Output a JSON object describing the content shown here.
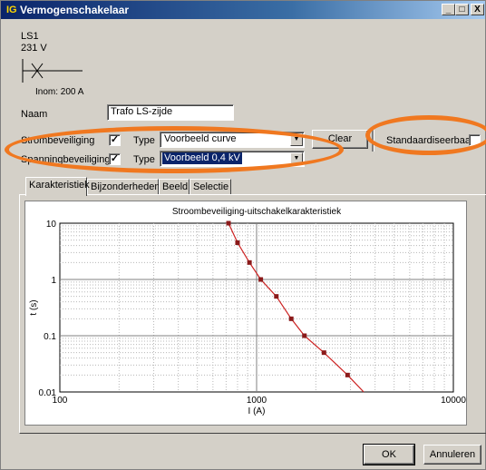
{
  "window": {
    "title": "Vermogenschakelaar",
    "app_icon": "IG",
    "controls": {
      "minimize": "_",
      "maximize": "□",
      "close": "X"
    }
  },
  "symbol": {
    "name": "LS1",
    "voltage": "231 V",
    "inom": "Inom: 200 A"
  },
  "form": {
    "naam_label": "Naam",
    "naam_value": "Trafo LS-zijde",
    "stroom_label": "Strombeveiliging",
    "stroom_checked": true,
    "type_label": "Type",
    "stroom_type": "Voorbeeld curve",
    "spanning_label": "Spanningbeveiliging",
    "spanning_checked": true,
    "spanning_type": "Voorbeeld 0,4 kV",
    "clear_label": "Clear",
    "standaard_label": "Standaardiseerbaar",
    "standaard_checked": false,
    "check_mark": "✓"
  },
  "tabs": [
    {
      "label": "Karakteristiek",
      "active": true
    },
    {
      "label": "Bijzonderheden",
      "active": false
    },
    {
      "label": "Beeld",
      "active": false
    },
    {
      "label": "Selectie",
      "active": false
    }
  ],
  "chart_data": {
    "type": "line",
    "title": "Stroombeveiliging-uitschakelkarakteristiek",
    "xlabel": "I (A)",
    "ylabel": "t (s)",
    "x_scale": "log",
    "y_scale": "log",
    "xlim": [
      100,
      10000
    ],
    "ylim": [
      0.01,
      10
    ],
    "x_ticks": [
      "100",
      "1000",
      "10000"
    ],
    "y_ticks": [
      "10",
      "1",
      "0.1",
      "0.01"
    ],
    "grid": true,
    "series": [
      {
        "color": "#cc2020",
        "marker_color": "#8b1a1a",
        "points": [
          [
            720,
            10
          ],
          [
            800,
            4.5
          ],
          [
            920,
            2.0
          ],
          [
            1050,
            1.0
          ],
          [
            1260,
            0.5
          ],
          [
            1500,
            0.2
          ],
          [
            1750,
            0.1
          ],
          [
            2200,
            0.05
          ],
          [
            2900,
            0.02
          ],
          [
            3500,
            0.01
          ]
        ],
        "marker_count": 9
      }
    ]
  },
  "footer": {
    "ok_label": "OK",
    "cancel_label": "Annuleren"
  },
  "annotations": {
    "highlight_color": "#f07820"
  }
}
